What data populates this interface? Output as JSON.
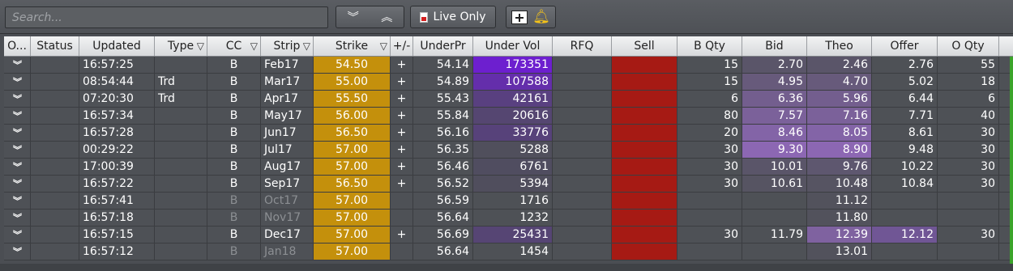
{
  "search": {
    "placeholder": "Search..."
  },
  "toolbar": {
    "live_label": "Live Only",
    "collapse_icon": "collapse-all",
    "expand_icon": "expand-all"
  },
  "colors": {
    "strike": "#c4900c",
    "sell": "#a61a14",
    "vol_strong": "#6d1fcf",
    "bid": "#8a63b2",
    "theo": "#9a6fc3"
  },
  "columns": [
    "O...",
    "Status",
    "Updated",
    "Type",
    "CC",
    "Strip",
    "Strike",
    "+/-",
    "UnderPr",
    "Under Vol",
    "RFQ",
    "Sell",
    "B Qty",
    "Bid",
    "Theo",
    "Offer",
    "O Qty"
  ],
  "rows": [
    {
      "updated": "16:57:25",
      "type": "",
      "cc": "B",
      "strip": "Feb17",
      "strike": "54.50",
      "pm": "+",
      "underpr": "54.14",
      "undervol": "173351",
      "bqty": "15",
      "bid": "2.70",
      "theo": "2.46",
      "offer": "2.76",
      "oqty": "55"
    },
    {
      "updated": "08:54:44",
      "type": "Trd",
      "cc": "B",
      "strip": "Mar17",
      "strike": "55.00",
      "pm": "+",
      "underpr": "54.89",
      "undervol": "107588",
      "bqty": "15",
      "bid": "4.95",
      "theo": "4.70",
      "offer": "5.02",
      "oqty": "18"
    },
    {
      "updated": "07:20:30",
      "type": "Trd",
      "cc": "B",
      "strip": "Apr17",
      "strike": "55.50",
      "pm": "+",
      "underpr": "55.43",
      "undervol": "42161",
      "bqty": "6",
      "bid": "6.36",
      "theo": "5.96",
      "offer": "6.44",
      "oqty": "6"
    },
    {
      "updated": "16:57:34",
      "type": "",
      "cc": "B",
      "strip": "May17",
      "strike": "56.00",
      "pm": "+",
      "underpr": "55.84",
      "undervol": "20616",
      "bqty": "80",
      "bid": "7.57",
      "theo": "7.16",
      "offer": "7.71",
      "oqty": "40"
    },
    {
      "updated": "16:57:28",
      "type": "",
      "cc": "B",
      "strip": "Jun17",
      "strike": "56.50",
      "pm": "+",
      "underpr": "56.16",
      "undervol": "33776",
      "bqty": "20",
      "bid": "8.46",
      "theo": "8.05",
      "offer": "8.61",
      "oqty": "30"
    },
    {
      "updated": "00:29:22",
      "type": "",
      "cc": "B",
      "strip": "Jul17",
      "strike": "57.00",
      "pm": "+",
      "underpr": "56.35",
      "undervol": "5288",
      "bqty": "30",
      "bid": "9.30",
      "theo": "8.90",
      "offer": "9.48",
      "oqty": "30"
    },
    {
      "updated": "17:00:39",
      "type": "",
      "cc": "B",
      "strip": "Aug17",
      "strike": "57.00",
      "pm": "+",
      "underpr": "56.46",
      "undervol": "6761",
      "bqty": "30",
      "bid": "10.01",
      "theo": "9.76",
      "offer": "10.22",
      "oqty": "30"
    },
    {
      "updated": "16:57:22",
      "type": "",
      "cc": "B",
      "strip": "Sep17",
      "strike": "56.50",
      "pm": "+",
      "underpr": "56.52",
      "undervol": "5394",
      "bqty": "30",
      "bid": "10.61",
      "theo": "10.48",
      "offer": "10.84",
      "oqty": "30"
    },
    {
      "updated": "16:57:41",
      "type": "",
      "cc": "B",
      "strip": "Oct17",
      "strike": "57.00",
      "pm": "",
      "underpr": "56.59",
      "undervol": "1716",
      "bqty": "",
      "bid": "",
      "theo": "11.12",
      "offer": "",
      "oqty": "",
      "dim": true
    },
    {
      "updated": "16:57:18",
      "type": "",
      "cc": "B",
      "strip": "Nov17",
      "strike": "57.00",
      "pm": "",
      "underpr": "56.64",
      "undervol": "1232",
      "bqty": "",
      "bid": "",
      "theo": "11.80",
      "offer": "",
      "oqty": "",
      "dim": true
    },
    {
      "updated": "16:57:15",
      "type": "",
      "cc": "B",
      "strip": "Dec17",
      "strike": "57.00",
      "pm": "+",
      "underpr": "56.69",
      "undervol": "25431",
      "bqty": "30",
      "bid": "11.79",
      "theo": "12.39",
      "offer": "12.12",
      "oqty": "30"
    },
    {
      "updated": "16:57:12",
      "type": "",
      "cc": "B",
      "strip": "Jan18",
      "strike": "57.00",
      "pm": "",
      "underpr": "56.64",
      "undervol": "1454",
      "bqty": "",
      "bid": "",
      "theo": "13.01",
      "offer": "",
      "oqty": "",
      "dim": true
    }
  ],
  "vol_shade": [
    1.0,
    0.7,
    0.35,
    0.22,
    0.3,
    0.05,
    0.08,
    0.06,
    0.0,
    0.0,
    0.25,
    0.0
  ],
  "bid_shade": [
    0.15,
    0.3,
    0.45,
    0.55,
    0.65,
    0.75,
    0.15,
    0.1,
    0,
    0,
    0,
    0
  ],
  "theo_shade": [
    0.15,
    0.3,
    0.45,
    0.55,
    0.65,
    0.75,
    0.2,
    0.1,
    0.05,
    0.05,
    0.6,
    0.05
  ]
}
